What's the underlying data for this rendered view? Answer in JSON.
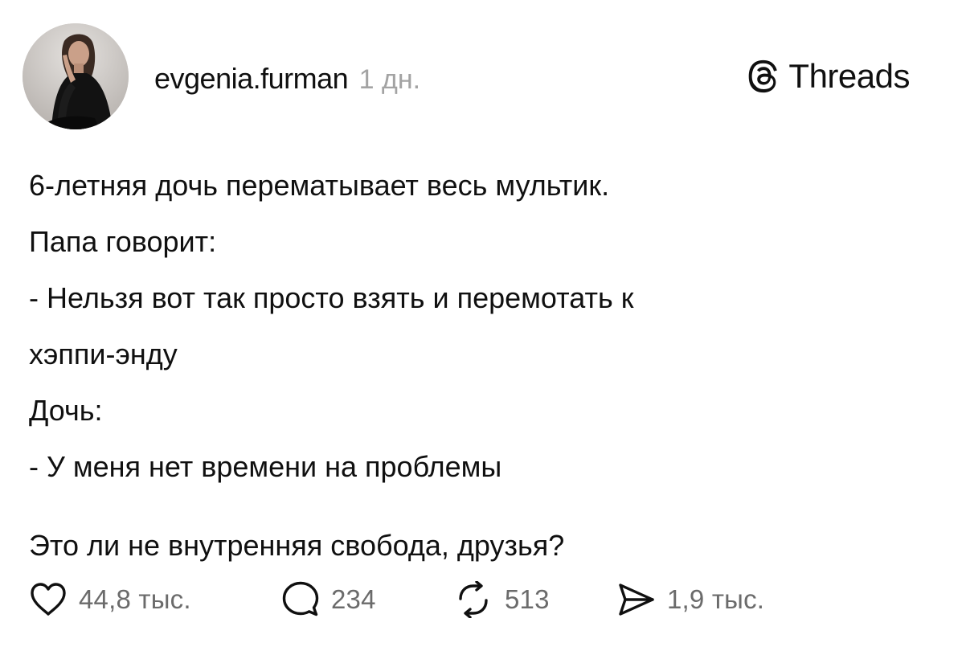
{
  "header": {
    "username": "evgenia.furman",
    "time": "1 дн.",
    "brand": "Threads",
    "brand_icon": "threads-logo-icon"
  },
  "post": {
    "lines": [
      "6-летняя дочь перематывает весь мультик.",
      "Папа говорит:",
      "- Нельзя вот так просто взять и перемотать к",
      "хэппи-энду",
      "Дочь:",
      "- У меня нет времени на проблемы"
    ],
    "closing": "Это ли не внутренняя свобода, друзья?"
  },
  "actions": {
    "likes": "44,8 тыс.",
    "replies": "234",
    "reposts": "513",
    "shares": "1,9 тыс."
  },
  "colors": {
    "text": "#101010",
    "muted": "#a3a3a3",
    "count": "#6b6b6b",
    "background": "#ffffff"
  }
}
